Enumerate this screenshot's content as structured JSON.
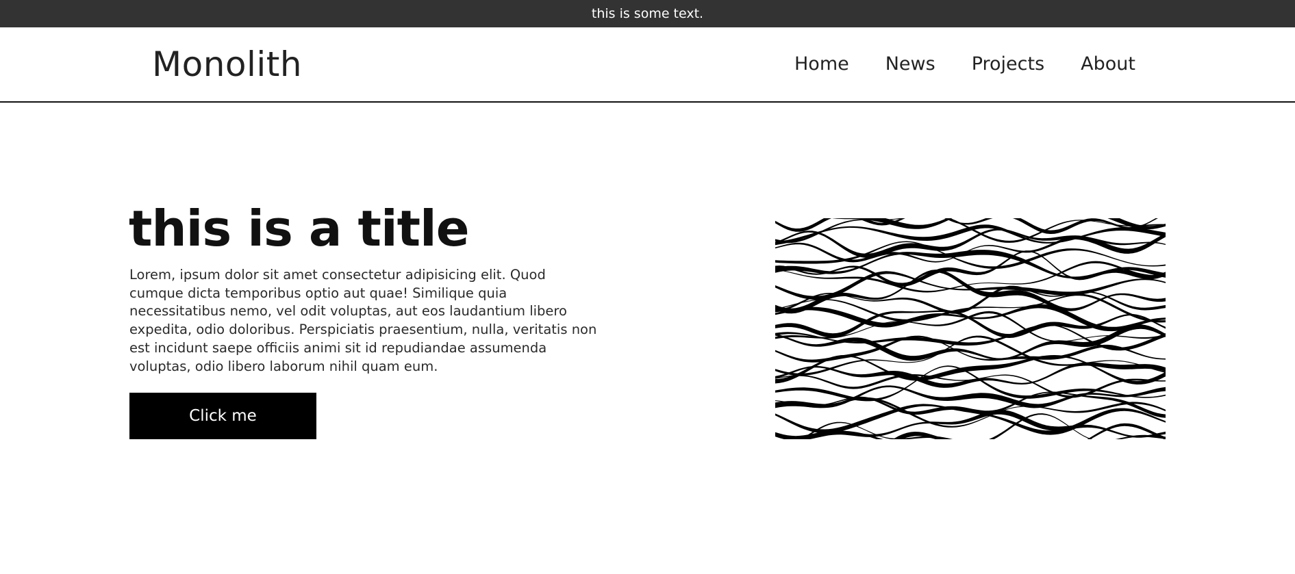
{
  "announcement": {
    "text": "this is some text."
  },
  "header": {
    "logo": "Monolith",
    "nav": [
      {
        "label": "Home"
      },
      {
        "label": "News"
      },
      {
        "label": "Projects"
      },
      {
        "label": "About"
      }
    ]
  },
  "hero": {
    "title": "this is a title",
    "body": "Lorem, ipsum dolor sit amet consectetur adipisicing elit. Quod cumque dicta temporibus optio aut quae! Similique quia necessitatibus nemo, vel odit voluptas, aut eos laudantium libero expedita, odio doloribus. Perspiciatis praesentium, nulla, veritatis non est incidunt saepe officiis animi sit id repudiandae assumenda voluptas, odio libero laborum nihil quam eum.",
    "button_label": "Click me",
    "image": {
      "description": "",
      "colors": {
        "stripe": "#000000",
        "background": "#ffffff"
      }
    }
  },
  "colors": {
    "topbar_bg": "#333333",
    "topbar_text": "#ffffff",
    "text_primary": "#222222",
    "button_bg": "#000000",
    "button_text": "#ffffff"
  }
}
